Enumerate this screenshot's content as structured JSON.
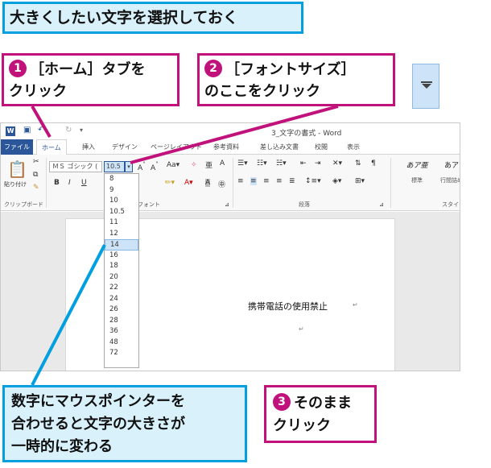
{
  "instruction": "大きくしたい文字を選択しておく",
  "callouts": {
    "c1": {
      "num": "1",
      "line1": "［ホーム］タブを",
      "line2": "クリック"
    },
    "c2": {
      "num": "2",
      "line1": "［フォントサイズ］",
      "line2": "のここをクリック"
    },
    "c3": {
      "num": "3",
      "line1": "そのまま",
      "line2": "クリック"
    },
    "c4": {
      "line1": "数字にマウスポインターを",
      "line2": "合わせると文字の大きさが",
      "line3": "一時的に変わる"
    }
  },
  "window": {
    "title": "3_文字の書式 - Word"
  },
  "tabs": [
    "ファイル",
    "ホーム",
    "挿入",
    "デザイン",
    "ページレイアウト",
    "参考資料",
    "差し込み文書",
    "校閲",
    "表示"
  ],
  "ribbon": {
    "paste_label": "貼り付け",
    "clipboard_label": "クリップボード",
    "font_label": "フォント",
    "paragraph_label": "段落",
    "styles_label": "スタイ",
    "font_name": "ＭＳ ゴシック (",
    "font_size": "10.5",
    "styles": [
      {
        "sample": "あア亜",
        "name": "標準"
      },
      {
        "sample": "あア",
        "name": "行間詰め"
      }
    ]
  },
  "size_options": [
    "8",
    "9",
    "10",
    "10.5",
    "11",
    "12",
    "14",
    "16",
    "18",
    "20",
    "22",
    "24",
    "26",
    "28",
    "36",
    "48",
    "72"
  ],
  "document": {
    "text": "携帯電話の使用禁止",
    "para_mark": "↵"
  },
  "colors": {
    "blue": "#00a0e0",
    "magenta": "#c0127a",
    "word_blue": "#2b579a"
  }
}
